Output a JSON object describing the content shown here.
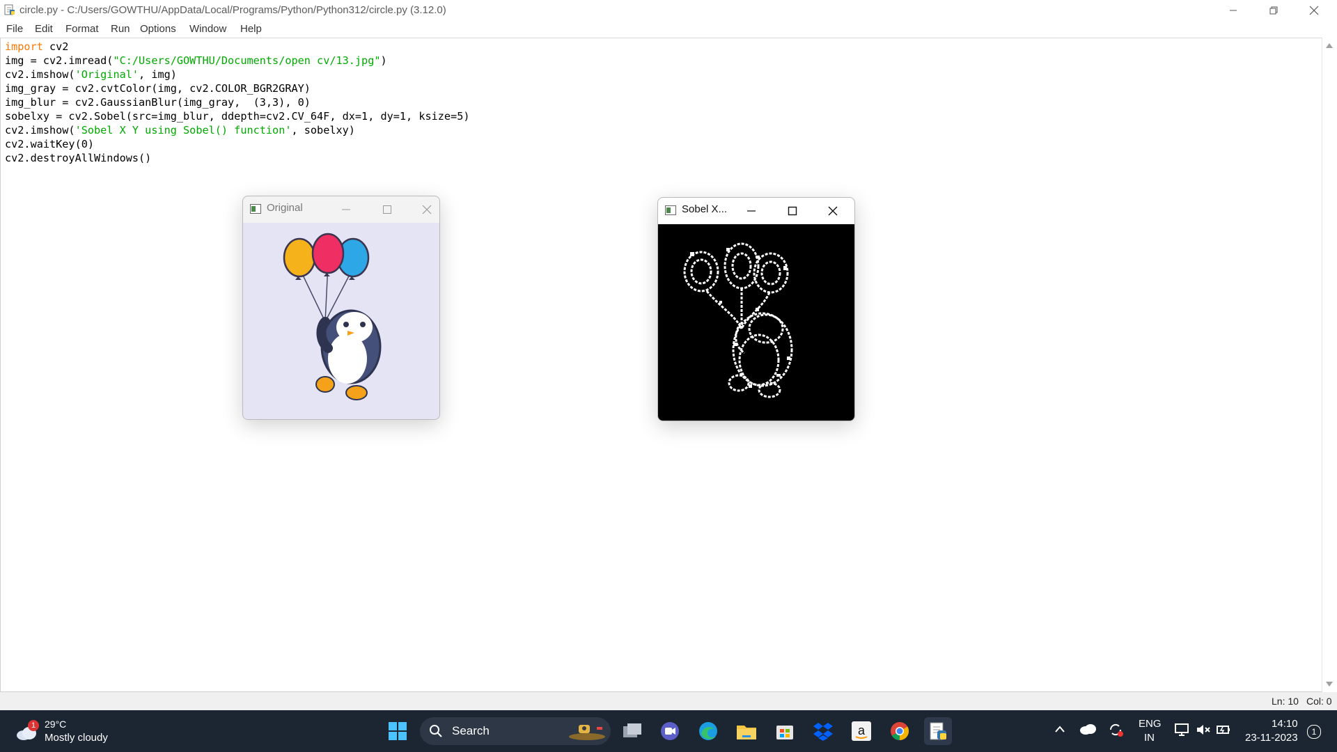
{
  "window": {
    "title": "circle.py - C:/Users/GOWTHU/AppData/Local/Programs/Python/Python312/circle.py (3.12.0)"
  },
  "menu": [
    "File",
    "Edit",
    "Format",
    "Run",
    "Options",
    "Window",
    "Help"
  ],
  "code_lines": [
    [
      {
        "t": "import",
        "c": "kw"
      },
      {
        "t": " cv2",
        "c": ""
      }
    ],
    [
      {
        "t": "img = cv2.imread(",
        "c": ""
      },
      {
        "t": "\"C:/Users/GOWTHU/Documents/open cv/13.jpg\"",
        "c": "str"
      },
      {
        "t": ")",
        "c": ""
      }
    ],
    [
      {
        "t": "cv2.imshow(",
        "c": ""
      },
      {
        "t": "'Original'",
        "c": "str"
      },
      {
        "t": ", img)",
        "c": ""
      }
    ],
    [
      {
        "t": "img_gray = cv2.cvtColor(img, cv2.COLOR_BGR2GRAY)",
        "c": ""
      }
    ],
    [
      {
        "t": "img_blur = cv2.GaussianBlur(img_gray,  (3,3), 0)",
        "c": ""
      }
    ],
    [
      {
        "t": "sobelxy = cv2.Sobel(src=img_blur, ddepth=cv2.CV_64F, dx=1, dy=1, ksize=5)",
        "c": ""
      }
    ],
    [
      {
        "t": "cv2.imshow(",
        "c": ""
      },
      {
        "t": "'Sobel X Y using Sobel() function'",
        "c": "str"
      },
      {
        "t": ", sobelxy)",
        "c": ""
      }
    ],
    [
      {
        "t": "cv2.waitKey(0)",
        "c": ""
      }
    ],
    [
      {
        "t": "cv2.destroyAllWindows()",
        "c": ""
      }
    ]
  ],
  "status": {
    "line": "Ln: 10",
    "col": "Col: 0"
  },
  "original_window": {
    "title": "Original",
    "image": "penguin-with-balloons",
    "background": "#e4e4f4"
  },
  "sobel_window": {
    "title": "Sobel X...",
    "image": "sobel-edge-output",
    "background": "#000000"
  },
  "colors": {
    "keyword": "#ff7700",
    "string": "#00aa00",
    "taskbar": "#1c2532"
  },
  "taskbar": {
    "weather": {
      "badge": "1",
      "temp": "29°C",
      "desc": "Mostly cloudy"
    },
    "search_label": "Search",
    "apps": [
      "windows-start-icon",
      "task-view-icon",
      "teams-icon",
      "edge-icon",
      "file-explorer-icon",
      "store-icon",
      "dropbox-icon",
      "amazon-icon",
      "chrome-icon",
      "python-idle-icon"
    ],
    "language": {
      "line1": "ENG",
      "line2": "IN"
    },
    "time": "14:10",
    "date": "23-11-2023",
    "notification_count": "1"
  }
}
